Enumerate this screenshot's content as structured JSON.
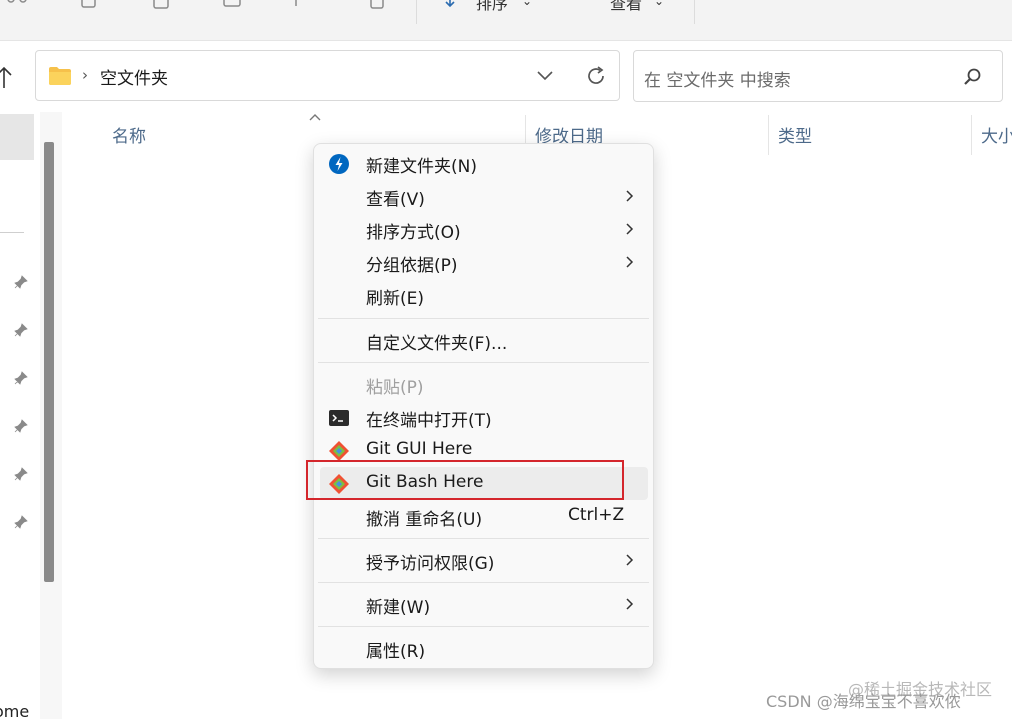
{
  "toolbar": {
    "sort_label": "排序",
    "view_label": "查看",
    "more_label": "···"
  },
  "address": {
    "crumb": "空文件夹"
  },
  "search": {
    "placeholder": "在 空文件夹 中搜索"
  },
  "columns": {
    "name": "名称",
    "modified": "修改日期",
    "type": "类型",
    "size": "大小"
  },
  "sidebar": {
    "partial_text": "ome"
  },
  "context_menu": {
    "items": [
      {
        "label": "新建文件夹(N)",
        "icon": "new-folder-icon",
        "submenu": false
      },
      {
        "label": "查看(V)",
        "submenu": true
      },
      {
        "label": "排序方式(O)",
        "submenu": true
      },
      {
        "label": "分组依据(P)",
        "submenu": true
      },
      {
        "label": "刷新(E)",
        "submenu": false
      },
      {
        "label": "自定义文件夹(F)...",
        "submenu": false
      },
      {
        "label": "粘贴(P)",
        "submenu": false,
        "disabled": true
      },
      {
        "label": "在终端中打开(T)",
        "icon": "terminal-icon",
        "submenu": false
      },
      {
        "label": "Git GUI Here",
        "icon": "git-icon",
        "submenu": false
      },
      {
        "label": "Git Bash Here",
        "icon": "git-icon",
        "submenu": false,
        "highlighted": true
      },
      {
        "label": "撤消 重命名(U)",
        "shortcut": "Ctrl+Z",
        "submenu": false
      },
      {
        "label": "授予访问权限(G)",
        "submenu": true
      },
      {
        "label": "新建(W)",
        "submenu": true
      },
      {
        "label": "属性(R)",
        "submenu": false
      }
    ]
  },
  "watermark": {
    "line1": "@稀土掘金技术社区",
    "line2": "CSDN @海绵宝宝不喜欢侬"
  },
  "colors": {
    "accent_blue": "#0067c0",
    "highlight_box": "#d4262c",
    "git_orange": "#f05133"
  }
}
